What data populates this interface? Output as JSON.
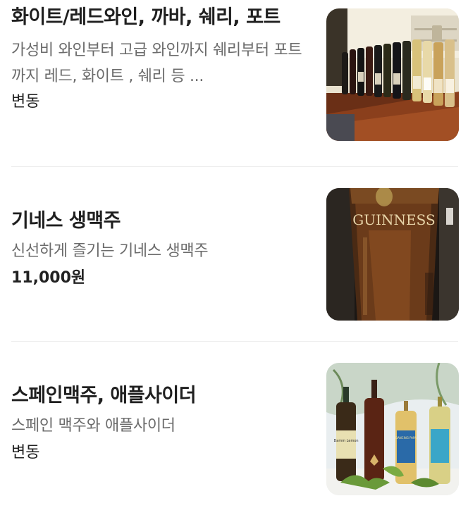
{
  "menu": {
    "items": [
      {
        "title": "화이트/레드와인, 까바, 쉐리, 포트",
        "description": "가성비 와인부터 고급 와인까지 쉐리부터 포트까지 레드, 화이트 , 쉐리 등 ...",
        "price": "변동",
        "photo": "wine-bottles-photo"
      },
      {
        "title": "기네스 생맥주",
        "description": "신선하게 즐기는 기네스 생맥주",
        "price": "11,000원",
        "photo": "guinness-pint-photo",
        "photo_label": "GUINNESS"
      },
      {
        "title": "스페인맥주, 애플사이더",
        "description": "스페인 맥주와 애플사이더",
        "price": "변동",
        "photo": "spanish-beer-cider-photo",
        "photo_labels": [
          "Damm Lemon",
          "DANCING PAPA"
        ]
      }
    ]
  }
}
